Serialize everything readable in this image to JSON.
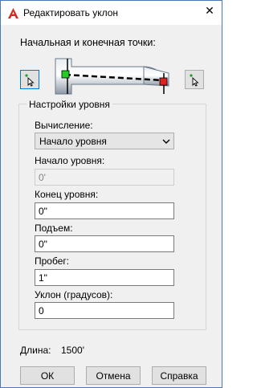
{
  "window": {
    "title": "Редактировать уклон",
    "close_glyph": "✕",
    "app_icon": "autocad-logo-icon"
  },
  "points": {
    "label": "Начальная и конечная точки:",
    "left_button_icon": "pick-point-icon",
    "right_button_icon": "pick-point-icon"
  },
  "level_settings": {
    "group_title": "Настройки уровня",
    "calculation": {
      "label": "Вычисление:",
      "selected": "Начало уровня"
    },
    "start_level": {
      "label": "Начало уровня:",
      "value": "0'"
    },
    "end_level": {
      "label": "Конец уровня:",
      "value": "0\""
    },
    "rise": {
      "label": "Подъем:",
      "value": "0\""
    },
    "run": {
      "label": "Пробег:",
      "value": "1\""
    },
    "slope": {
      "label": "Уклон (градусов):",
      "value": "0"
    }
  },
  "length": {
    "label": "Длина:",
    "value": "1500'"
  },
  "buttons": {
    "ok": "ОК",
    "cancel": "Отмена",
    "help": "Справка"
  },
  "colors": {
    "accent": "#0078d7",
    "start_point": "#22cc22",
    "end_point": "#dd2222",
    "logo": "#d52b1e"
  }
}
